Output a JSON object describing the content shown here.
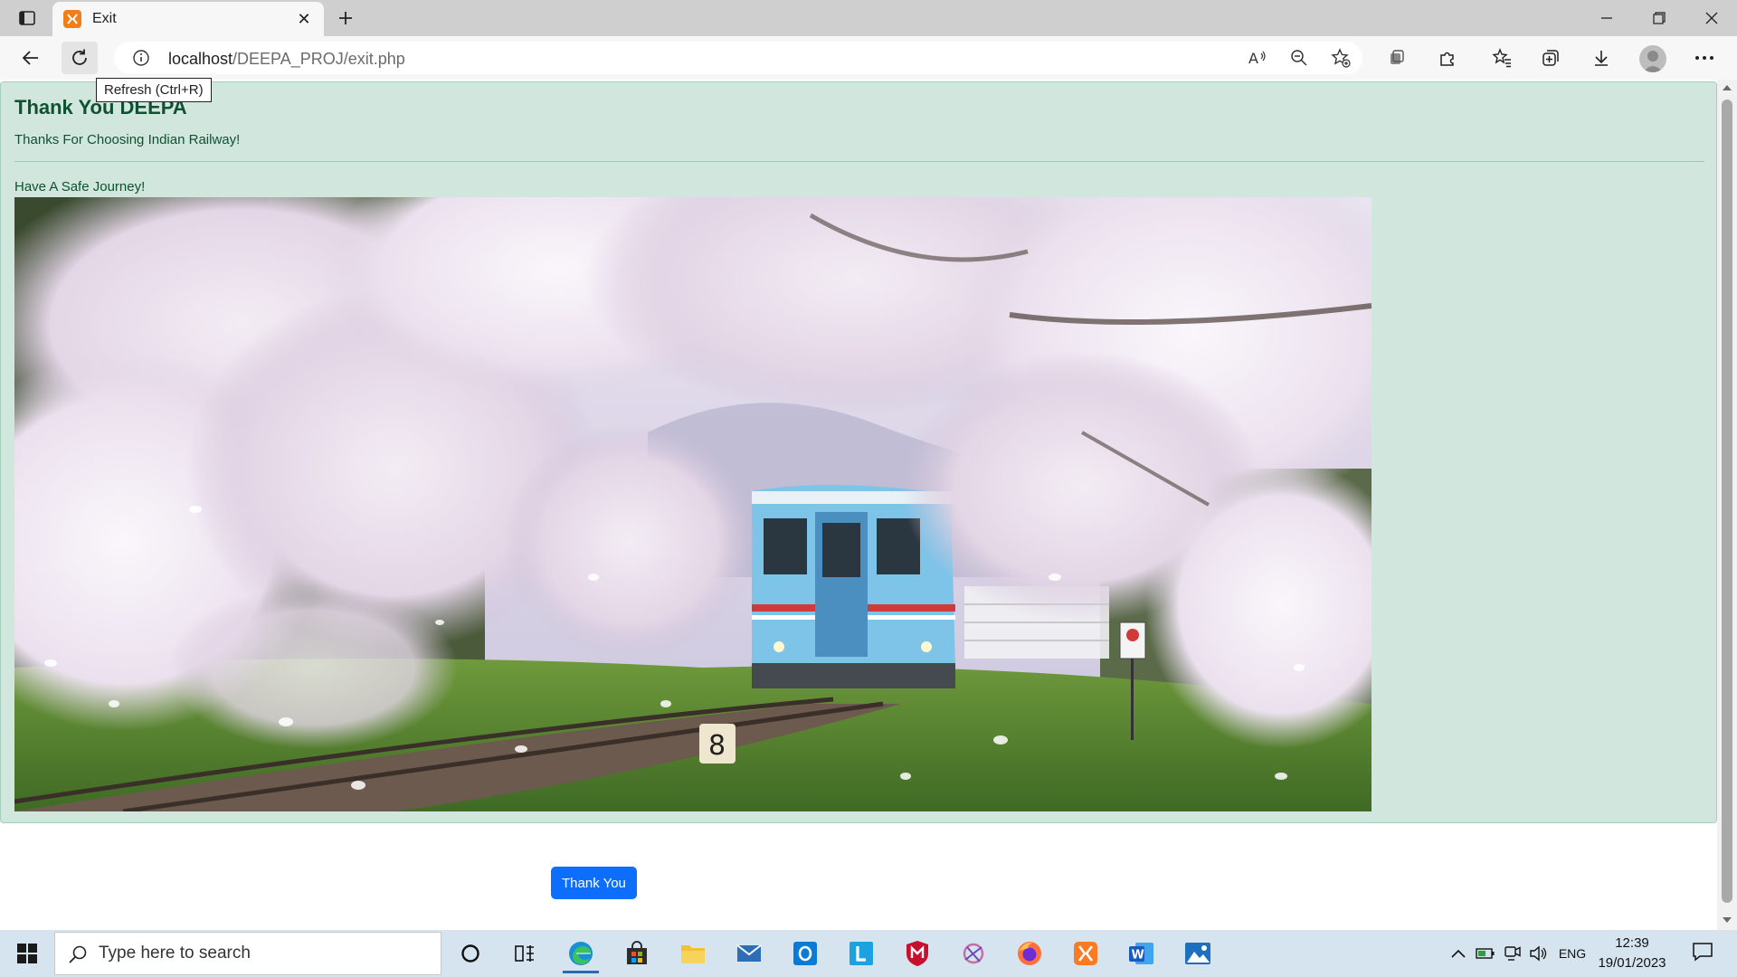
{
  "browser": {
    "tab_title": "Exit",
    "url_host": "localhost",
    "url_path": "/DEEPA_PROJ/exit.php",
    "tooltip": "Refresh (Ctrl+R)"
  },
  "page": {
    "heading": "Thank You DEEPA",
    "line1": "Thanks For Choosing Indian Railway!",
    "line2": "Have A Safe Journey!",
    "image_subject": "train-through-cherry-blossoms",
    "button_label": "Thank You",
    "colors": {
      "alert_bg": "#d1e7dd",
      "alert_text": "#0f5132",
      "button_bg": "#0d6efd"
    }
  },
  "taskbar": {
    "search_placeholder": "Type here to search",
    "apps": [
      "cortana",
      "task-view",
      "edge",
      "store",
      "file-explorer",
      "mail",
      "outlook",
      "app-l",
      "mcafee",
      "snip",
      "firefox",
      "xampp",
      "word",
      "photos"
    ],
    "language": "ENG",
    "time": "12:39",
    "date": "19/01/2023"
  }
}
